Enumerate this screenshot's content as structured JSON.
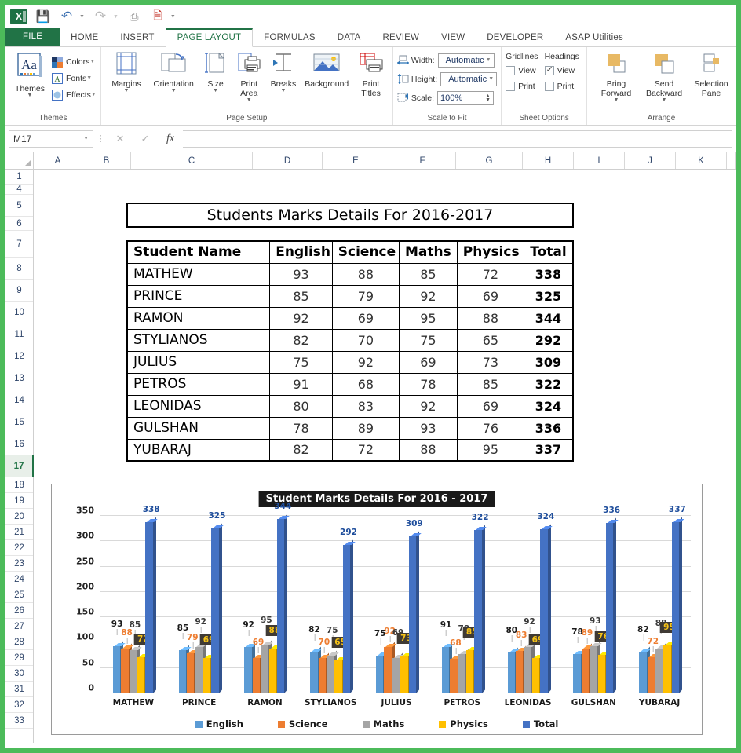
{
  "quick_access": {
    "logo": "excel-logo",
    "items": [
      {
        "name": "save-icon",
        "glyph": "💾"
      },
      {
        "name": "undo-icon",
        "glyph": "↶"
      },
      {
        "name": "redo-icon",
        "glyph": "↷"
      },
      {
        "name": "touch-mode-icon",
        "glyph": "✇"
      },
      {
        "name": "pdf-icon",
        "glyph": "📄"
      },
      {
        "name": "customize-qat-icon",
        "glyph": "☰"
      }
    ]
  },
  "ribbon": {
    "tabs": [
      {
        "label": "FILE",
        "active": false,
        "file": true
      },
      {
        "label": "HOME",
        "active": false
      },
      {
        "label": "INSERT",
        "active": false
      },
      {
        "label": "PAGE LAYOUT",
        "active": true
      },
      {
        "label": "FORMULAS",
        "active": false
      },
      {
        "label": "DATA",
        "active": false
      },
      {
        "label": "REVIEW",
        "active": false
      },
      {
        "label": "VIEW",
        "active": false
      },
      {
        "label": "DEVELOPER",
        "active": false
      },
      {
        "label": "ASAP Utilities",
        "active": false
      }
    ],
    "groups": {
      "themes": {
        "label": "Themes",
        "big": {
          "label": "Themes",
          "icon": "themes-icon"
        },
        "small": [
          {
            "label": "Colors",
            "icon": "colors-icon"
          },
          {
            "label": "Fonts",
            "icon": "fonts-icon"
          },
          {
            "label": "Effects",
            "icon": "effects-icon"
          }
        ]
      },
      "page_setup": {
        "label": "Page Setup",
        "buttons": [
          {
            "label": "Margins",
            "icon": "margins-icon",
            "dropdown": true
          },
          {
            "label": "Orientation",
            "icon": "orientation-icon",
            "dropdown": true
          },
          {
            "label": "Size",
            "icon": "size-icon",
            "dropdown": true
          },
          {
            "label": "Print Area",
            "icon": "print-area-icon",
            "dropdown": true
          },
          {
            "label": "Breaks",
            "icon": "breaks-icon",
            "dropdown": true
          },
          {
            "label": "Background",
            "icon": "background-icon",
            "dropdown": false
          },
          {
            "label": "Print Titles",
            "icon": "print-titles-icon",
            "dropdown": false
          }
        ]
      },
      "scale_to_fit": {
        "label": "Scale to Fit",
        "rows": [
          {
            "label": "Width:",
            "value": "Automatic",
            "icon": "width-icon",
            "type": "combo"
          },
          {
            "label": "Height:",
            "value": "Automatic",
            "icon": "height-icon",
            "type": "combo"
          },
          {
            "label": "Scale:",
            "value": "100%",
            "icon": "scale-icon",
            "type": "spin"
          }
        ]
      },
      "sheet_options": {
        "label": "Sheet Options",
        "columns": [
          {
            "header": "Gridlines",
            "checks": [
              {
                "label": "View",
                "checked": false
              },
              {
                "label": "Print",
                "checked": false
              }
            ]
          },
          {
            "header": "Headings",
            "checks": [
              {
                "label": "View",
                "checked": true
              },
              {
                "label": "Print",
                "checked": false
              }
            ]
          }
        ]
      },
      "arrange": {
        "label": "Arrange",
        "buttons": [
          {
            "label": "Bring Forward",
            "icon": "bring-forward-icon",
            "dropdown": true
          },
          {
            "label": "Send Backward",
            "icon": "send-backward-icon",
            "dropdown": true
          },
          {
            "label": "Selection Pane",
            "icon": "selection-pane-icon",
            "dropdown": false
          }
        ]
      }
    }
  },
  "formula_bar": {
    "name_box": "M17",
    "cancel_icon": "cancel-icon",
    "enter_icon": "enter-icon",
    "function_icon": "insert-function-icon",
    "formula_value": "",
    "formula_placeholder": ""
  },
  "grid": {
    "columns": [
      "A",
      "B",
      "C",
      "D",
      "E",
      "F",
      "G",
      "H",
      "I",
      "J",
      "K"
    ],
    "rows": [
      "1",
      "4",
      "5",
      "6",
      "7",
      "8",
      "9",
      "10",
      "11",
      "12",
      "13",
      "14",
      "15",
      "16",
      "17",
      "18",
      "19",
      "20",
      "21",
      "22",
      "23",
      "24",
      "25",
      "26",
      "27",
      "28",
      "29",
      "30",
      "31",
      "32",
      "33"
    ],
    "selected_row": "17"
  },
  "sheet": {
    "title_banner": "Students Marks Details For 2016-2017",
    "table": {
      "headers": [
        "Student Name",
        "English",
        "Science",
        "Maths",
        "Physics",
        "Total"
      ],
      "rows": [
        [
          "MATHEW",
          "93",
          "88",
          "85",
          "72",
          "338"
        ],
        [
          "PRINCE",
          "85",
          "79",
          "92",
          "69",
          "325"
        ],
        [
          "RAMON",
          "92",
          "69",
          "95",
          "88",
          "344"
        ],
        [
          "STYLIANOS",
          "82",
          "70",
          "75",
          "65",
          "292"
        ],
        [
          "JULIUS",
          "75",
          "92",
          "69",
          "73",
          "309"
        ],
        [
          "PETROS",
          "91",
          "68",
          "78",
          "85",
          "322"
        ],
        [
          "LEONIDAS",
          "80",
          "83",
          "92",
          "69",
          "324"
        ],
        [
          "GULSHAN",
          "78",
          "89",
          "93",
          "76",
          "336"
        ],
        [
          "YUBARAJ",
          "82",
          "72",
          "88",
          "95",
          "337"
        ]
      ]
    }
  },
  "chart_data": {
    "type": "bar",
    "title": "Student Marks Details For 2016 - 2017",
    "xlabel": "",
    "ylabel": "",
    "ylim": [
      0,
      350
    ],
    "yticks": [
      0,
      50,
      100,
      150,
      200,
      250,
      300,
      350
    ],
    "grid": true,
    "legend_position": "bottom",
    "categories": [
      "MATHEW",
      "PRINCE",
      "RAMON",
      "STYLIANOS",
      "JULIUS",
      "PETROS",
      "LEONIDAS",
      "GULSHAN",
      "YUBARAJ"
    ],
    "series": [
      {
        "name": "English",
        "color": "#5b9bd5",
        "label_color": "#1a1a1a",
        "values": [
          93,
          85,
          92,
          82,
          75,
          91,
          80,
          78,
          82
        ]
      },
      {
        "name": "Science",
        "color": "#ed7d31",
        "label_color": "#ed7d31",
        "values": [
          88,
          79,
          69,
          70,
          92,
          68,
          83,
          89,
          72
        ]
      },
      {
        "name": "Maths",
        "color": "#a5a5a5",
        "label_color": "#3a3a3a",
        "values": [
          85,
          92,
          95,
          75,
          69,
          78,
          92,
          93,
          88
        ]
      },
      {
        "name": "Physics",
        "color": "#ffc000",
        "label_color": "#f6c318",
        "values": [
          72,
          69,
          88,
          65,
          73,
          85,
          69,
          76,
          95
        ]
      },
      {
        "name": "Total",
        "color": "#4472c4",
        "label_color": "#1f4e9c",
        "values": [
          338,
          325,
          344,
          292,
          309,
          322,
          324,
          336,
          337
        ]
      }
    ]
  }
}
